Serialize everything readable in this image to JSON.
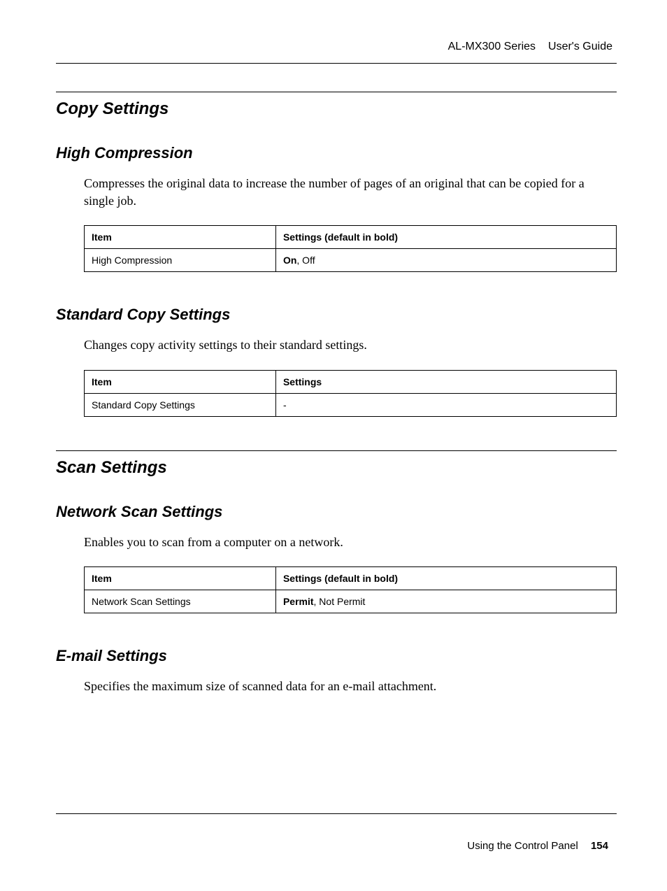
{
  "header": {
    "product": "AL-MX300 Series",
    "doc_type": "User's Guide"
  },
  "sections": {
    "copy_settings": {
      "title": "Copy Settings",
      "high_compression": {
        "title": "High Compression",
        "description": "Compresses the original data to increase the number of pages of an original that can be copied for a single job.",
        "table": {
          "header_item": "Item",
          "header_settings": "Settings (default in bold)",
          "row_item": "High Compression",
          "row_default": "On",
          "row_rest": ", Off"
        }
      },
      "standard_copy": {
        "title": "Standard Copy Settings",
        "description": "Changes copy activity settings to their standard settings.",
        "table": {
          "header_item": "Item",
          "header_settings": "Settings",
          "row_item": "Standard Copy Settings",
          "row_value": "-"
        }
      }
    },
    "scan_settings": {
      "title": "Scan Settings",
      "network_scan": {
        "title": "Network Scan Settings",
        "description": "Enables you to scan from a computer on a network.",
        "table": {
          "header_item": "Item",
          "header_settings": "Settings (default in bold)",
          "row_item": "Network Scan Settings",
          "row_default": "Permit",
          "row_rest": ", Not Permit"
        }
      },
      "email": {
        "title": "E-mail Settings",
        "description": "Specifies the maximum size of scanned data for an e-mail attachment."
      }
    }
  },
  "footer": {
    "chapter": "Using the Control Panel",
    "page": "154"
  }
}
